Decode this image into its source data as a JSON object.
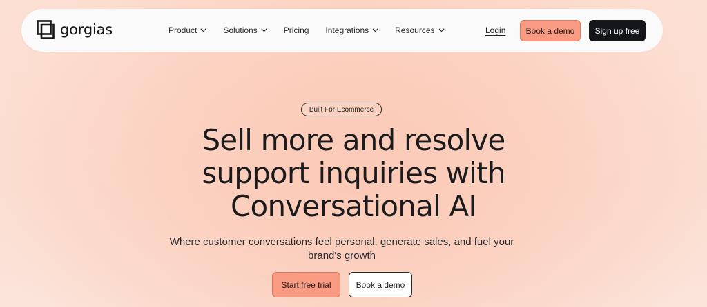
{
  "brand": {
    "name": "gorgias",
    "logo_icon": "gorgias-logo-icon"
  },
  "nav": {
    "items": [
      {
        "label": "Product",
        "has_dropdown": true,
        "icon": "chevron-down-icon"
      },
      {
        "label": "Solutions",
        "has_dropdown": true,
        "icon": "chevron-down-icon"
      },
      {
        "label": "Pricing",
        "has_dropdown": false
      },
      {
        "label": "Integrations",
        "has_dropdown": true,
        "icon": "chevron-down-icon"
      },
      {
        "label": "Resources",
        "has_dropdown": true,
        "icon": "chevron-down-icon"
      }
    ],
    "login_label": "Login",
    "demo_label": "Book a demo",
    "signup_label": "Sign up free"
  },
  "hero": {
    "badge": "Built For Ecommerce",
    "headline_lines": [
      "Sell more and resolve",
      "support inquiries with",
      "Conversational AI"
    ],
    "subheadline": "Where customer conversations feel personal, generate sales, and fuel your brand's growth",
    "primary_cta": "Start free trial",
    "secondary_cta": "Book a demo"
  },
  "colors": {
    "accent": "#f99a82",
    "dark_button": "#15161a",
    "background": "#fbd7c8"
  }
}
